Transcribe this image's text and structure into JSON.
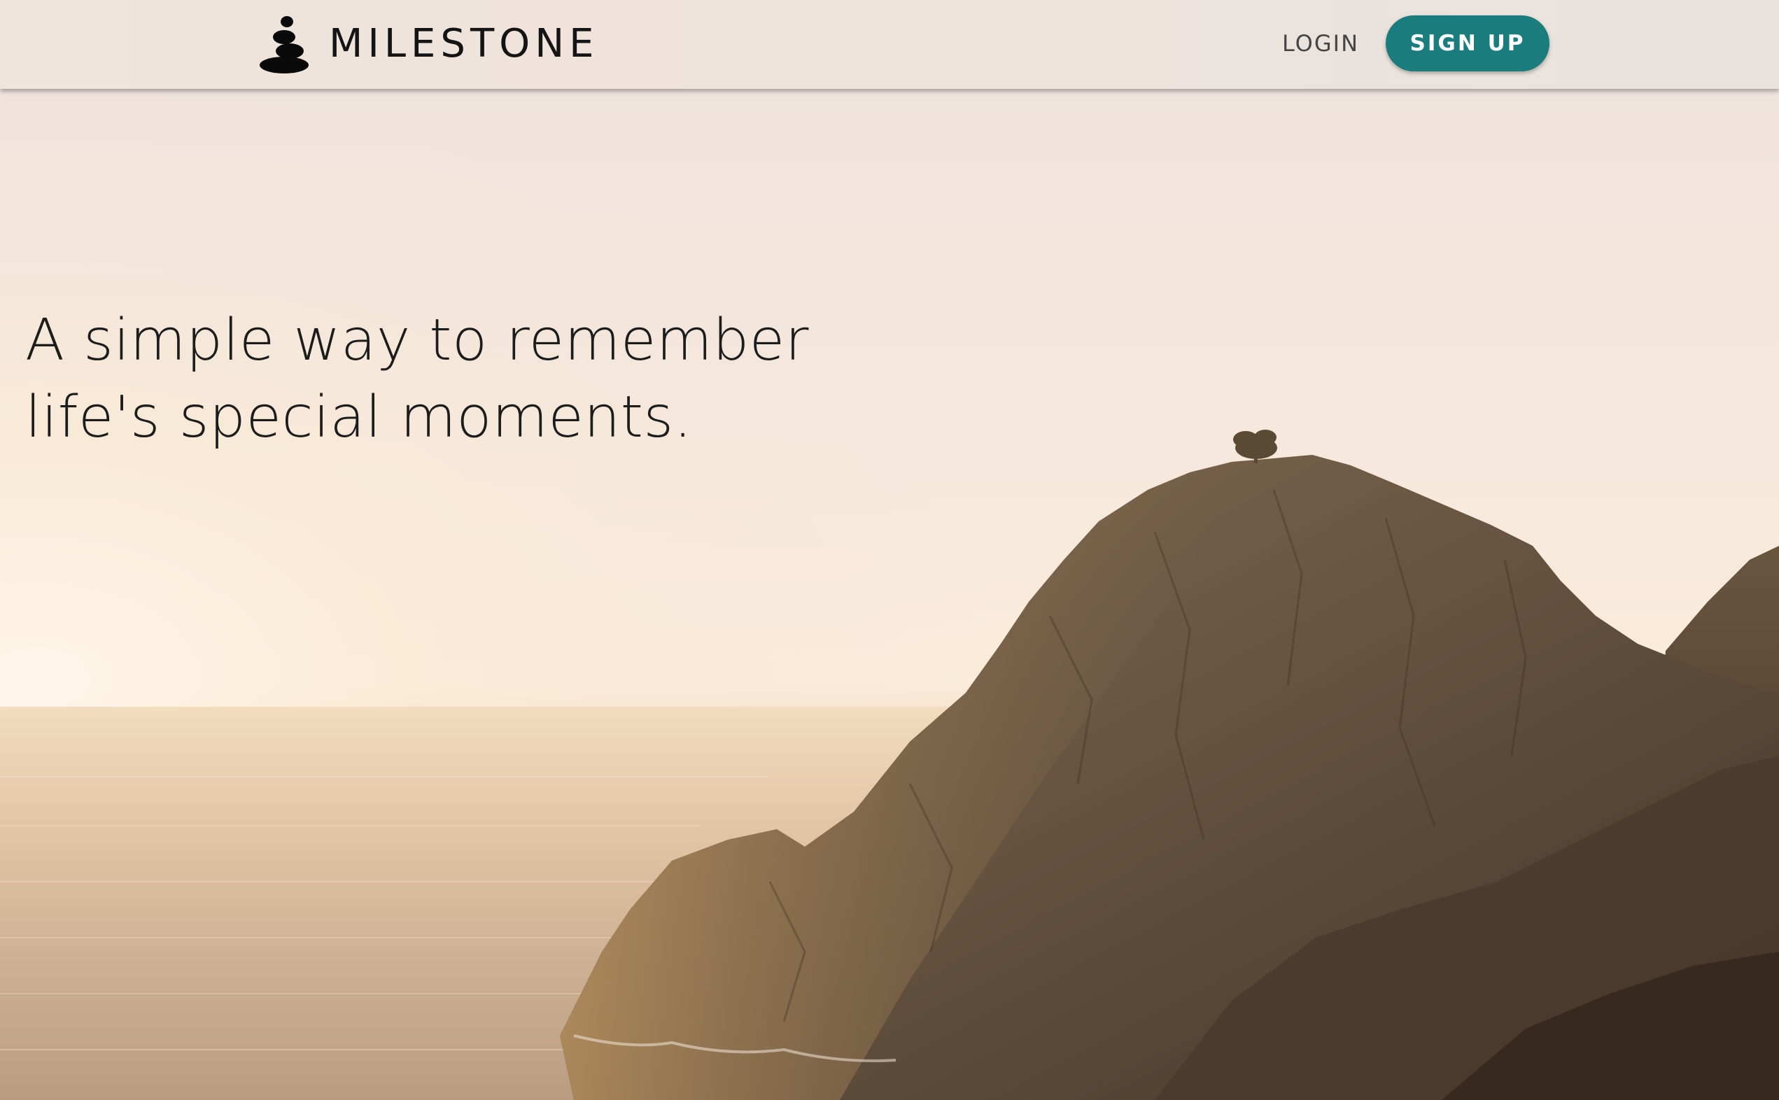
{
  "brand": {
    "name": "MILESTONE",
    "logo_icon": "stacked-stones-icon"
  },
  "nav": {
    "login_label": "LOGIN",
    "signup_label": "SIGN UP"
  },
  "hero": {
    "headline_line1": "A simple way to remember",
    "headline_line2": "life's special moments."
  },
  "colors": {
    "accent": "#1a7c7c",
    "navbar_bg": "#ede4dd",
    "text_dark": "#1c1c1c",
    "sky_top": "#efe4de",
    "sun_glow": "#fcefdf",
    "sea": "#c9ab8e",
    "rock": "#6b5744"
  }
}
